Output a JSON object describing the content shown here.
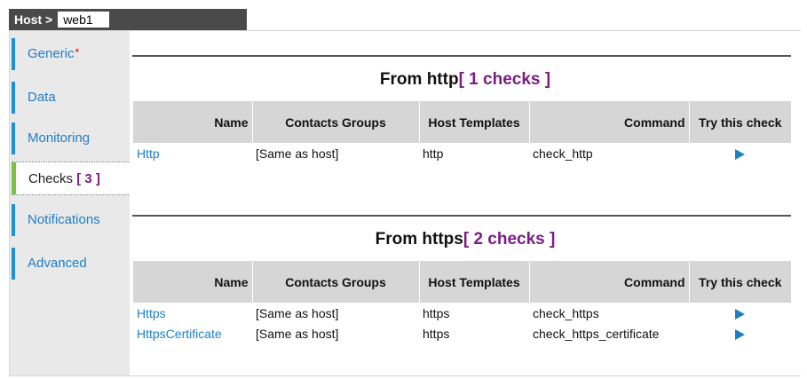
{
  "title_bar": {
    "label": "Host >",
    "host_name": "web1"
  },
  "sidebar": {
    "items": [
      {
        "label": "Generic",
        "required_mark": "*"
      },
      {
        "label": "Data"
      },
      {
        "label": "Monitoring"
      },
      {
        "label": "Checks",
        "count": "[ 3 ]"
      },
      {
        "label": "Notifications"
      },
      {
        "label": "Advanced"
      }
    ],
    "active": "Checks",
    "accent_color": "#1f8fd6",
    "active_color": "#7cc14e"
  },
  "sections": [
    {
      "title": "From http",
      "count_label": "[ 1 checks ]",
      "columns": [
        "Name",
        "Contacts Groups",
        "Host Templates",
        "Command",
        "Try this check"
      ],
      "rows": [
        {
          "name": "Http",
          "contacts_groups": "[Same as host]",
          "host_templates": "http",
          "command": "check_http",
          "try_icon": "play-icon"
        }
      ]
    },
    {
      "title": "From https",
      "count_label": "[ 2 checks ]",
      "columns": [
        "Name",
        "Contacts Groups",
        "Host Templates",
        "Command",
        "Try this check"
      ],
      "rows": [
        {
          "name": "Https",
          "contacts_groups": "[Same as host]",
          "host_templates": "https",
          "command": "check_https",
          "try_icon": "play-icon"
        },
        {
          "name": "HttpsCertificate",
          "contacts_groups": "[Same as host]",
          "host_templates": "https",
          "command": "check_https_certificate",
          "try_icon": "play-icon"
        }
      ]
    }
  ],
  "colors": {
    "link": "#1f7fc4",
    "count": "#7b1d84",
    "header_bg": "#d6d6d6"
  }
}
